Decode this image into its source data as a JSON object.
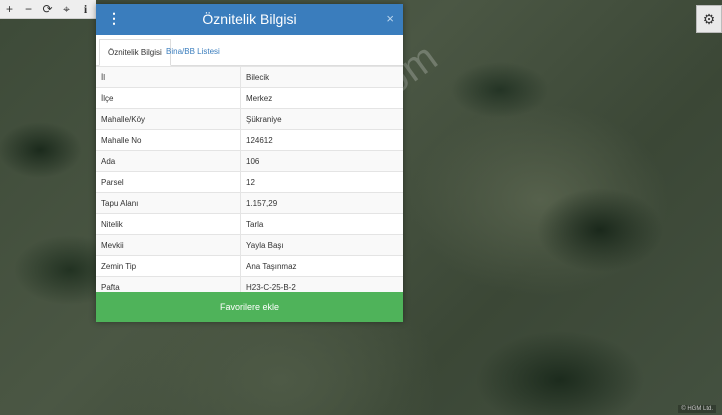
{
  "toolbar": {
    "tools": [
      {
        "name": "zoom-in-icon",
        "glyph": "+"
      },
      {
        "name": "zoom-out-icon",
        "glyph": "−"
      },
      {
        "name": "refresh-icon",
        "glyph": "⟳"
      },
      {
        "name": "locate-icon",
        "glyph": "⌖"
      },
      {
        "name": "info-icon",
        "glyph": "i"
      }
    ]
  },
  "settings_glyph": "⚙",
  "watermark": "emlakjet.com",
  "map_attribution": "© HGM Ltd.",
  "panel": {
    "title": "Öznitelik Bilgisi",
    "menu_glyph": "⋮",
    "close_glyph": "×",
    "tabs": [
      "Öznitelik Bilgisi",
      "Bina/BB Listesi"
    ],
    "rows": [
      {
        "key": "İl",
        "value": "Bilecik"
      },
      {
        "key": "İlçe",
        "value": "Merkez"
      },
      {
        "key": "Mahalle/Köy",
        "value": "Şükraniye"
      },
      {
        "key": "Mahalle No",
        "value": "124612"
      },
      {
        "key": "Ada",
        "value": "106"
      },
      {
        "key": "Parsel",
        "value": "12"
      },
      {
        "key": "Tapu Alanı",
        "value": "1.157,29"
      },
      {
        "key": "Nitelik",
        "value": "Tarla"
      },
      {
        "key": "Mevkii",
        "value": "Yayla Başı"
      },
      {
        "key": "Zemin Tip",
        "value": "Ana Taşınmaz"
      },
      {
        "key": "Pafta",
        "value": "H23-C-25-B-2"
      }
    ],
    "favorite_button": "Favorilere ekle"
  },
  "colors": {
    "header": "#3a7dbd",
    "favorite": "#4fb35a"
  }
}
